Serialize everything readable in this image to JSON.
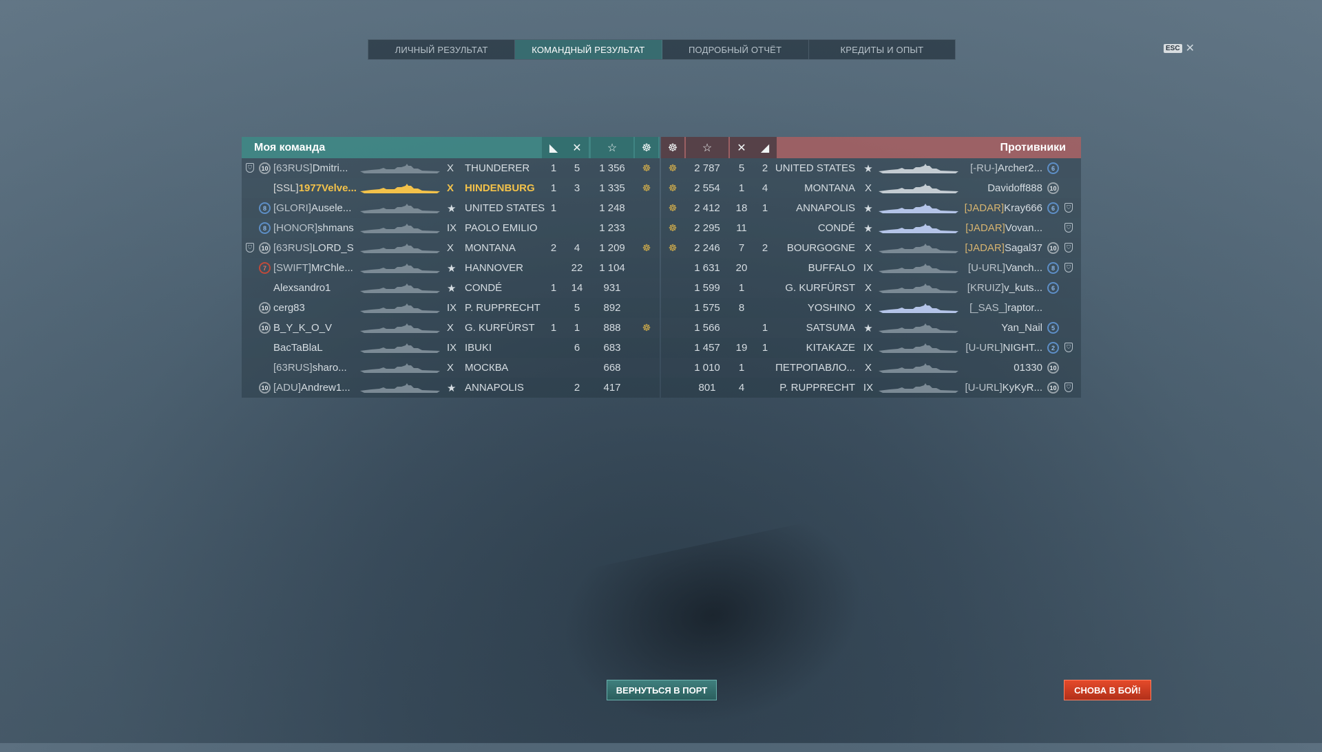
{
  "tabs": [
    {
      "label": "ЛИЧНЫЙ РЕЗУЛЬТАТ",
      "active": false
    },
    {
      "label": "КОМАНДНЫЙ РЕЗУЛЬТАТ",
      "active": true
    },
    {
      "label": "ПОДРОБНЫЙ ОТЧЁТ",
      "active": false
    },
    {
      "label": "КРЕДИТЫ И ОПЫТ",
      "active": false
    }
  ],
  "esc": {
    "key": "ESC",
    "close": "✕"
  },
  "my_team": {
    "title": "Моя команда",
    "header_icons": [
      "ship-destroyed-icon",
      "aircraft-destroyed-icon",
      "base-xp-icon",
      "commendation-icon"
    ],
    "header_glyphs": [
      "◣",
      "✕",
      "☆",
      "☸"
    ],
    "rows": [
      {
        "division": "⛉",
        "rank": "10",
        "clan": "[63RUS]",
        "name": "Dmitri...",
        "tier": "X",
        "ship": "THUNDERER",
        "kills": "1",
        "planes": "5",
        "xp": "1 356",
        "medal": "☸",
        "me": false
      },
      {
        "division": "",
        "rank": "",
        "clan": "[SSL]",
        "name": "1977Velve...",
        "tier": "X",
        "ship": "HINDENBURG",
        "kills": "1",
        "planes": "3",
        "xp": "1 335",
        "medal": "☸",
        "me": true
      },
      {
        "division": "",
        "rank": "8",
        "clan": "[GLORI]",
        "name": "Ausele...",
        "tier": "★",
        "ship": "UNITED STATES",
        "kills": "1",
        "planes": "",
        "xp": "1 248",
        "medal": "",
        "me": false
      },
      {
        "division": "",
        "rank": "8",
        "clan": "[HONOR]",
        "name": "shmans",
        "tier": "IX",
        "ship": "PAOLO EMILIO",
        "kills": "",
        "planes": "",
        "xp": "1 233",
        "medal": "",
        "me": false
      },
      {
        "division": "⛉",
        "rank": "10",
        "clan": "[63RUS]",
        "name": "LORD_S",
        "tier": "X",
        "ship": "MONTANA",
        "kills": "2",
        "planes": "4",
        "xp": "1 209",
        "medal": "☸",
        "me": false
      },
      {
        "division": "",
        "rank": "7",
        "clan": "[SWIFT]",
        "name": "MrChle...",
        "tier": "★",
        "ship": "HANNOVER",
        "kills": "",
        "planes": "22",
        "xp": "1 104",
        "medal": "",
        "me": false
      },
      {
        "division": "",
        "rank": "",
        "clan": "",
        "name": "Alexsandro1",
        "tier": "★",
        "ship": "CONDÉ",
        "kills": "1",
        "planes": "14",
        "xp": "931",
        "medal": "",
        "me": false
      },
      {
        "division": "",
        "rank": "10",
        "clan": "",
        "name": "cerg83",
        "tier": "IX",
        "ship": "P. RUPPRECHT",
        "kills": "",
        "planes": "5",
        "xp": "892",
        "medal": "",
        "me": false
      },
      {
        "division": "",
        "rank": "10",
        "clan": "",
        "name": "B_Y_K_O_V",
        "tier": "X",
        "ship": "G. KURFÜRST",
        "kills": "1",
        "planes": "1",
        "xp": "888",
        "medal": "☸",
        "me": false
      },
      {
        "division": "",
        "rank": "",
        "clan": "",
        "name": "BacTaBlaL",
        "tier": "IX",
        "ship": "IBUKI",
        "kills": "",
        "planes": "6",
        "xp": "683",
        "medal": "",
        "me": false
      },
      {
        "division": "",
        "rank": "",
        "clan": "[63RUS]",
        "name": "sharo...",
        "tier": "X",
        "ship": "МОСКВА",
        "kills": "",
        "planes": "",
        "xp": "668",
        "medal": "",
        "me": false
      },
      {
        "division": "",
        "rank": "10",
        "clan": "[ADU]",
        "name": "Andrew1...",
        "tier": "★",
        "ship": "ANNAPOLIS",
        "kills": "",
        "planes": "2",
        "xp": "417",
        "medal": "",
        "me": false
      }
    ]
  },
  "enemy_team": {
    "title": "Противники",
    "header_icons": [
      "commendation-icon",
      "base-xp-icon",
      "aircraft-destroyed-icon",
      "ship-destroyed-icon"
    ],
    "header_glyphs": [
      "☸",
      "☆",
      "✕",
      "◢"
    ],
    "rows": [
      {
        "medal": "☸",
        "xp": "2 787",
        "planes": "5",
        "kills": "2",
        "ship": "UNITED STATES",
        "tier": "★",
        "clan": "[-RU-]",
        "name": "Archer2...",
        "rank": "6",
        "division": ""
      },
      {
        "medal": "☸",
        "xp": "2 554",
        "planes": "1",
        "kills": "4",
        "ship": "MONTANA",
        "tier": "X",
        "clan": "",
        "name": "Davidoff888",
        "rank": "10",
        "division": ""
      },
      {
        "medal": "☸",
        "xp": "2 412",
        "planes": "18",
        "kills": "1",
        "ship": "ANNAPOLIS",
        "tier": "★",
        "clan": "[JADAR]",
        "name": "Kray666",
        "rank": "6",
        "division": "⛉"
      },
      {
        "medal": "☸",
        "xp": "2 295",
        "planes": "11",
        "kills": "",
        "ship": "CONDÉ",
        "tier": "★",
        "clan": "[JADAR]",
        "name": "Vovan...",
        "rank": "",
        "division": "⛉"
      },
      {
        "medal": "☸",
        "xp": "2 246",
        "planes": "7",
        "kills": "2",
        "ship": "BOURGOGNE",
        "tier": "X",
        "clan": "[JADAR]",
        "name": "Sagal37",
        "rank": "10",
        "division": "⛉"
      },
      {
        "medal": "",
        "xp": "1 631",
        "planes": "20",
        "kills": "",
        "ship": "BUFFALO",
        "tier": "IX",
        "clan": "[U-URL]",
        "name": "Vanch...",
        "rank": "8",
        "division": "⛉"
      },
      {
        "medal": "",
        "xp": "1 599",
        "planes": "1",
        "kills": "",
        "ship": "G. KURFÜRST",
        "tier": "X",
        "clan": "[KRUIZ]",
        "name": "v_kuts...",
        "rank": "6",
        "division": ""
      },
      {
        "medal": "",
        "xp": "1 575",
        "planes": "8",
        "kills": "",
        "ship": "YOSHINO",
        "tier": "X",
        "clan": "[_SAS_]",
        "name": "raptor...",
        "rank": "",
        "division": ""
      },
      {
        "medal": "",
        "xp": "1 566",
        "planes": "",
        "kills": "1",
        "ship": "SATSUMA",
        "tier": "★",
        "clan": "",
        "name": "Yan_Nail",
        "rank": "5",
        "division": ""
      },
      {
        "medal": "",
        "xp": "1 457",
        "planes": "19",
        "kills": "1",
        "ship": "KITAKAZE",
        "tier": "IX",
        "clan": "[U-URL]",
        "name": "NIGHT...",
        "rank": "2",
        "division": "⛉"
      },
      {
        "medal": "",
        "xp": "1 010",
        "planes": "1",
        "kills": "",
        "ship": "ПЕТРОПАВЛО...",
        "tier": "X",
        "clan": "",
        "name": "01330",
        "rank": "10",
        "division": ""
      },
      {
        "medal": "",
        "xp": "801",
        "planes": "4",
        "kills": "",
        "ship": "P. RUPPRECHT",
        "tier": "IX",
        "clan": "[U-URL]",
        "name": "KyKyR...",
        "rank": "10",
        "division": "⛉"
      }
    ]
  },
  "buttons": {
    "return_port": "ВЕРНУТЬСЯ В ПОРТ",
    "battle_again": "СНОВА В БОЙ!"
  },
  "colors": {
    "accent_teal": "#3c8c87",
    "enemy_red": "#b45f5f",
    "highlight_gold": "#f3c24a",
    "battle_button": "#d8432a"
  }
}
